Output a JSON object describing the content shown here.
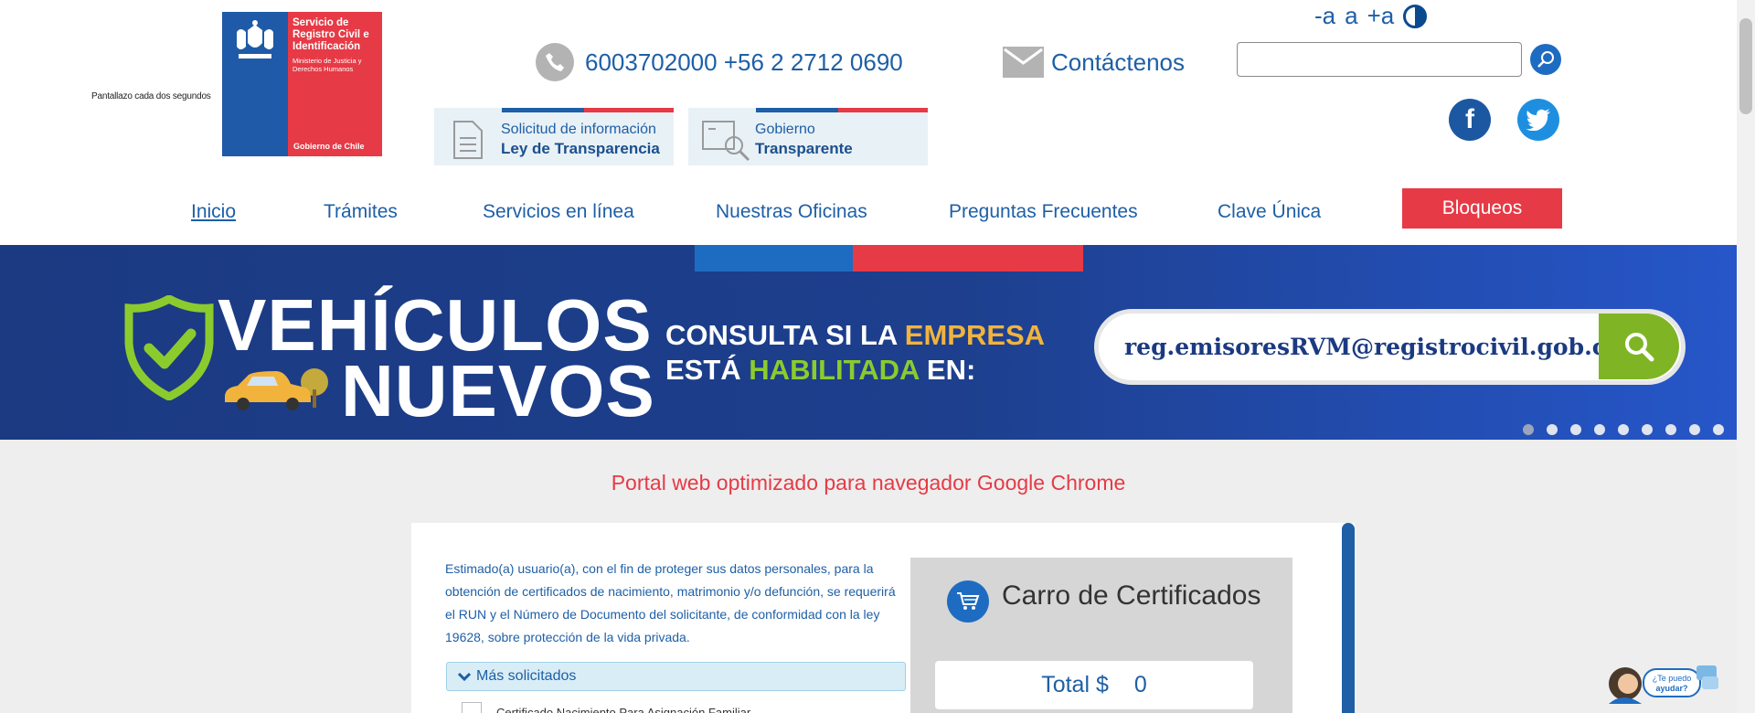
{
  "header": {
    "refresh_note": "Pantallazo cada dos segundos",
    "logo": {
      "title": "Servicio de Registro Civil e Identificación",
      "subtitle": "Ministerio de Justicia y Derechos Humanos",
      "footer": "Gobierno de Chile",
      "colors": {
        "blue": "#1f5aa8",
        "red": "#e63a46"
      }
    },
    "phone": "6003702000 +56 2 2712 0690",
    "contact": "Contáctenos",
    "font_controls": {
      "decrease": "-a",
      "normal": "a",
      "increase": "+a"
    },
    "search": {
      "placeholder": ""
    },
    "transparency_button": {
      "line1": "Solicitud de información",
      "line2": "Ley de Transparencia"
    },
    "gobierno_button": {
      "line1": "Gobierno",
      "line2": "Transparente"
    },
    "social": {
      "facebook": "f",
      "twitter": "twitter-icon"
    }
  },
  "nav": {
    "items": [
      {
        "label": "Inicio",
        "active": true
      },
      {
        "label": "Trámites"
      },
      {
        "label": "Servicios en línea"
      },
      {
        "label": "Nuestras Oficinas"
      },
      {
        "label": "Preguntas Frecuentes"
      },
      {
        "label": "Clave Única"
      }
    ],
    "bloqueos": "Bloqueos"
  },
  "hero": {
    "title_line1": "VEHÍCULOS",
    "title_line2": "NUEVOS",
    "consulta_line1_a": "CONSULTA SI LA ",
    "consulta_line1_b": "EMPRESA",
    "consulta_line2_a": "ESTÁ ",
    "consulta_line2_b": "HABILITADA",
    "consulta_line2_c": " EN:",
    "email": "reg.emisoresRVM@registrocivil.gob.cl",
    "slides_total": 9,
    "active_slide": 1,
    "colors": {
      "accent_yellow": "#f2b33d",
      "accent_green": "#8ccb2e"
    }
  },
  "content": {
    "chrome_note": "Portal web optimizado para navegador Google Chrome",
    "notice": "Estimado(a) usuario(a), con el fin de proteger sus datos personales, para la obtención de certificados de nacimiento, matrimonio y/o defunción, se requerirá el RUN y el Número de Documento del solicitante, de conformidad con la ley 19628, sobre protección de la vida privada.",
    "accordion_label": "Más solicitados",
    "first_item": "Certificado Nacimiento Para Asignación Familiar",
    "cart": {
      "title": "Carro de Certificados",
      "total_label": "Total $",
      "total_value": "0"
    },
    "help_label": "¿Te puedo ayudar?"
  }
}
